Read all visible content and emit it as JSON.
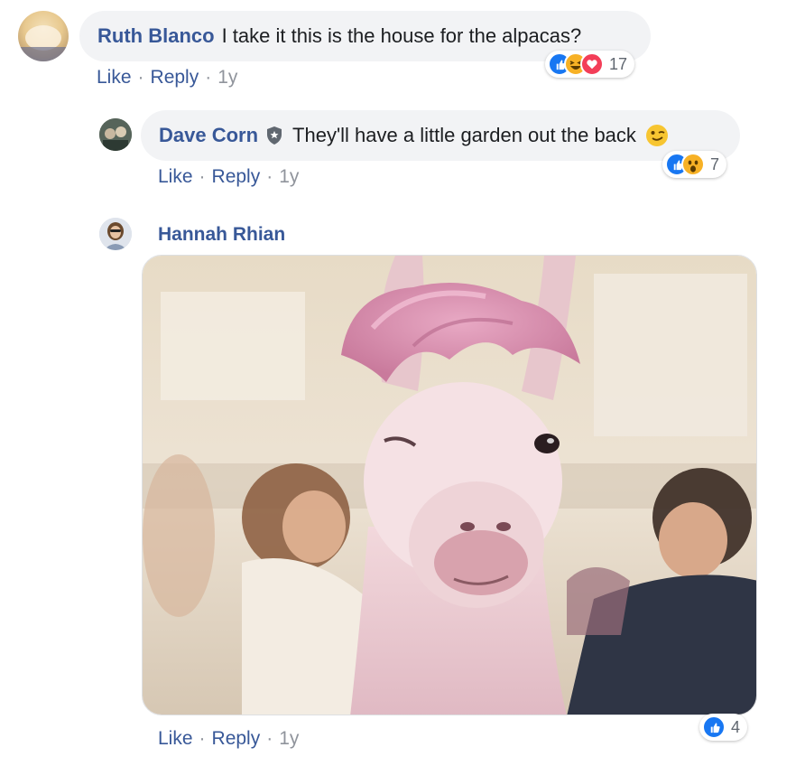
{
  "comments": [
    {
      "author": "Ruth Blanco",
      "text": "I take it this is the house for the alpacas?",
      "actions": {
        "like": "Like",
        "reply": "Reply",
        "time": "1y",
        "sep": "·"
      },
      "reactions": {
        "icons": [
          "like-icon",
          "haha-icon",
          "love-icon"
        ],
        "count": "17"
      }
    },
    {
      "author": "Dave Corn",
      "text": "They'll have a little garden out the back",
      "emoji": "😉",
      "badge": "admin-shield-icon",
      "actions": {
        "like": "Like",
        "reply": "Reply",
        "time": "1y",
        "sep": "·"
      },
      "reactions": {
        "icons": [
          "like-icon",
          "wow-icon"
        ],
        "count": "7"
      }
    },
    {
      "author": "Hannah Rhian",
      "media": "gif-llama-pink-hair",
      "actions": {
        "like": "Like",
        "reply": "Reply",
        "time": "1y",
        "sep": "·"
      },
      "reactions": {
        "icons": [
          "like-icon"
        ],
        "count": "4"
      }
    }
  ],
  "colors": {
    "link": "#385898",
    "bubble": "#f2f3f5",
    "meta": "#90949c",
    "like": "#1877f2"
  }
}
